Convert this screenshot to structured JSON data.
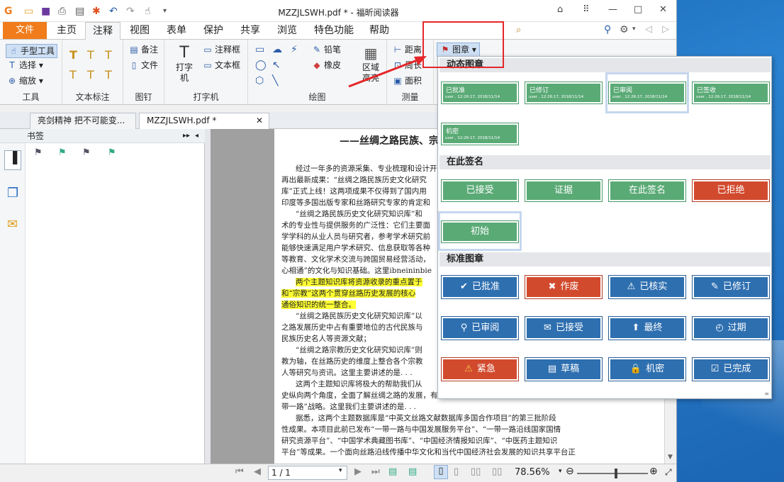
{
  "app": {
    "title": "MZZJLSWH.pdf * - 福昕阅读器",
    "file_tab": "文件",
    "tabs": [
      "主页",
      "注释",
      "视图",
      "表单",
      "保护",
      "共享",
      "浏览",
      "特色功能",
      "帮助"
    ],
    "search_placeholder": "查找"
  },
  "ribbon": {
    "tools_group": {
      "label": "工具",
      "items": [
        "手型工具",
        "选择",
        "缩放"
      ]
    },
    "text_markup_group": {
      "label": "文本标注"
    },
    "pin_group": {
      "label": "图钉",
      "items": [
        "备注",
        "文件"
      ]
    },
    "typewriter_group": {
      "label": "打字机",
      "main": "打字机",
      "items": [
        "注释框",
        "文本框"
      ]
    },
    "drawing_group": {
      "label": "绘图",
      "items": [
        "铅笔",
        "橡皮"
      ],
      "area": "区域高亮"
    },
    "measure_group": {
      "label": "测量",
      "items": [
        "距离",
        "周长",
        "面积"
      ]
    },
    "stamp_button": "图章"
  },
  "doc_tabs": [
    "亮剑精神 把不可能变...",
    "MZZJLSWH.pdf *"
  ],
  "sidebar": {
    "title": "书签"
  },
  "document": {
    "title": "——丝绸之路民族、宗",
    "lines": [
      {
        "text": "经过一年多的资源采集、专业梳理和设计开",
        "hl": false
      },
      {
        "text": "再出最新成果：“丝绸之路民族历史文化研究",
        "hl": false
      },
      {
        "text": "库”正式上线！这两项成果不仅得到了国内用",
        "hl": false
      },
      {
        "text": "印度等多国出版专家和丝路研究专家的肯定和",
        "hl": false
      },
      {
        "text": "“丝绸之路民族历史文化研究知识库”和",
        "hl": false
      },
      {
        "text": "术的专业性与提供服务的广泛性：它们主要面",
        "hl": false
      },
      {
        "text": "学学科的从业人员与研究者，参考学术研究前",
        "hl": false
      },
      {
        "text": "能够快速满足用户学术研究、信息获取等各种",
        "hl": false
      },
      {
        "text": "等教育、文化学术交流与跨国贸易经营活动，",
        "hl": false
      },
      {
        "text": "心相通”的文化与知识基础。这里ibneininbie",
        "hl": false
      },
      {
        "text": "两个主题知识库将资源收录的重点置于",
        "hl": true
      },
      {
        "text": "和“宗教”这两个贯穿丝路历史发展的核心",
        "hl": true
      },
      {
        "text": "通俗知识的统一整合。",
        "hl": true
      },
      {
        "text": "“丝绸之路民族历史文化研究知识库”以",
        "hl": false
      },
      {
        "text": "之路发展历史中占有重要地位的古代民族与",
        "hl": false
      },
      {
        "text": "民族历史名人等资源文献；",
        "hl": false
      },
      {
        "text": "“丝绸之路宗教历史文化研究知识库”则",
        "hl": false
      },
      {
        "text": "教为轴，在丝路历史的维度上整合各个宗教",
        "hl": false
      },
      {
        "text": "人等研究与资讯。这里主要讲述的是. . .",
        "hl": false
      },
      {
        "text": "这两个主题知识库将极大的帮助我们从",
        "hl": false
      },
      {
        "text": "史纵向两个角度，全面了解丝绸之路的发展，有助于更全面、更专业的理解国家的“一",
        "hl": false
      },
      {
        "text": "带一路”战略。这里我们主要讲述的是. . .",
        "hl": false
      },
      {
        "text": "据悉，这两个主题数据库是“中英文丝路文献数据库多国合作项目”的第三批阶段",
        "hl": false
      },
      {
        "text": "性成果。本项目此前已发布“一带一路与中国发展服务平台”、“一带一路沿线国家国情",
        "hl": false
      },
      {
        "text": "研究资源平台”、“中国学术典藏图书库”、“中国经济情报知识库”、“中医药主题知识",
        "hl": false
      },
      {
        "text": "平台”等成果。一个面向丝路沿线传播中华文化和当代中国经济社会发展的知识共享平台正",
        "hl": false
      }
    ]
  },
  "status": {
    "page": "1 / 1",
    "zoom": "78.56%",
    "zoom_fraction": 0.55
  },
  "stamp_panel": {
    "dynamic_title": "动态图章",
    "dynamic": [
      {
        "name": "已批准",
        "meta": "user , 12:26:17, 2018/11/14"
      },
      {
        "name": "已修订",
        "meta": "user , 12:26:17, 2018/11/14"
      },
      {
        "name": "已审阅",
        "meta": "user , 12:26:17, 2018/11/14"
      },
      {
        "name": "已签收",
        "meta": "user , 12:26:17, 2018/11/14"
      },
      {
        "name": "机密",
        "meta": "user , 12:26:17, 2018/11/14"
      }
    ],
    "sign_title": "在此签名",
    "sign": [
      "已接受",
      "证据",
      "在此签名",
      "已拒绝",
      "初始"
    ],
    "standard_title": "标准图章",
    "standard": [
      {
        "label": "已批准",
        "icon": "check-icon"
      },
      {
        "label": "作废",
        "icon": "x-icon"
      },
      {
        "label": "已核实",
        "icon": "warning-triangle-icon"
      },
      {
        "label": "已修订",
        "icon": "pen-icon"
      },
      {
        "label": "已审阅",
        "icon": "magnifier-icon"
      },
      {
        "label": "已接受",
        "icon": "envelope-icon"
      },
      {
        "label": "最终",
        "icon": "stamp-icon"
      },
      {
        "label": "过期",
        "icon": "clock-icon"
      },
      {
        "label": "紧急",
        "icon": "warning-icon"
      },
      {
        "label": "草稿",
        "icon": "document-icon"
      },
      {
        "label": "机密",
        "icon": "lock-icon"
      },
      {
        "label": "已完成",
        "icon": "checklist-icon"
      }
    ]
  },
  "colors": {
    "file_tab": "#f07c1c",
    "stamp_blue": "#2e6fb0",
    "stamp_green": "#5aaa76",
    "stamp_red": "#d24a2e",
    "highlight": "#ffff33",
    "callout": "#e5262a"
  }
}
